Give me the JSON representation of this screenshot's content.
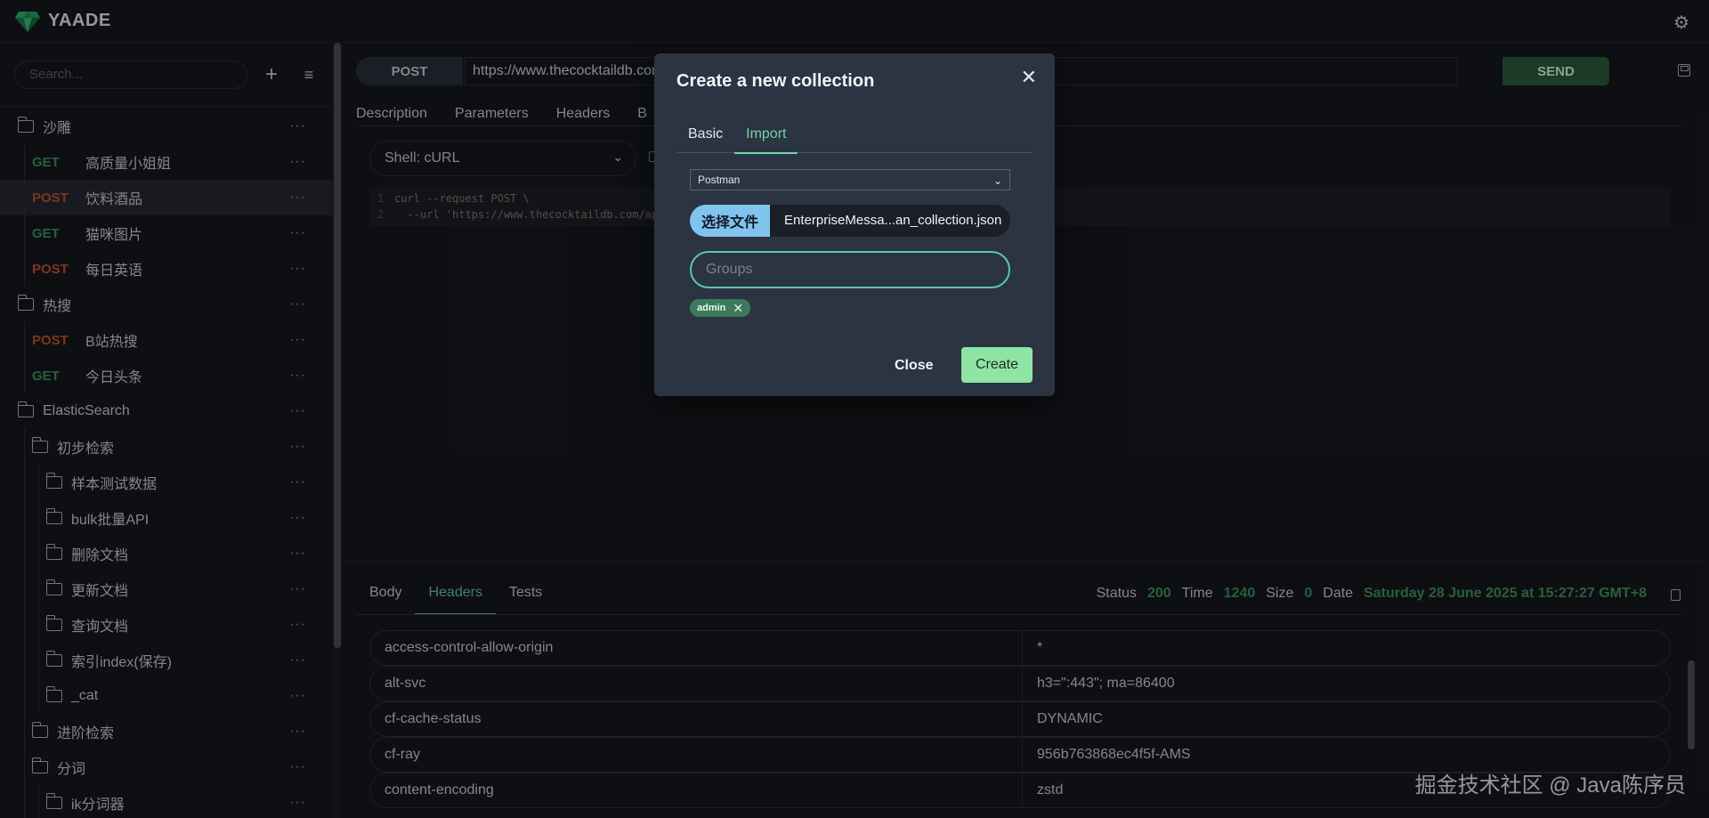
{
  "app": {
    "title": "YAADE"
  },
  "sidebar": {
    "search_placeholder": "Search...",
    "tree": [
      {
        "type": "folder",
        "label": "沙雕",
        "depth": 0
      },
      {
        "type": "request",
        "method": "GET",
        "label": "高质量小姐姐",
        "depth": 1
      },
      {
        "type": "request",
        "method": "POST",
        "label": "饮料酒品",
        "depth": 1,
        "selected": true
      },
      {
        "type": "request",
        "method": "GET",
        "label": "猫咪图片",
        "depth": 1
      },
      {
        "type": "request",
        "method": "POST",
        "label": "每日英语",
        "depth": 1
      },
      {
        "type": "folder",
        "label": "热搜",
        "depth": 0
      },
      {
        "type": "request",
        "method": "POST",
        "label": "B站热搜",
        "depth": 1
      },
      {
        "type": "request",
        "method": "GET",
        "label": "今日头条",
        "depth": 1
      },
      {
        "type": "folder",
        "label": "ElasticSearch",
        "depth": 0
      },
      {
        "type": "folder",
        "label": "初步检索",
        "depth": 1
      },
      {
        "type": "folder",
        "label": "样本测试数据",
        "depth": 2
      },
      {
        "type": "folder",
        "label": "bulk批量API",
        "depth": 2
      },
      {
        "type": "folder",
        "label": "删除文档",
        "depth": 2
      },
      {
        "type": "folder",
        "label": "更新文档",
        "depth": 2
      },
      {
        "type": "folder",
        "label": "查询文档",
        "depth": 2
      },
      {
        "type": "folder",
        "label": "索引index(保存)",
        "depth": 2
      },
      {
        "type": "folder",
        "label": "_cat",
        "depth": 2
      },
      {
        "type": "folder",
        "label": "进阶检索",
        "depth": 1
      },
      {
        "type": "folder",
        "label": "分词",
        "depth": 1
      },
      {
        "type": "folder",
        "label": "ik分词器",
        "depth": 2
      }
    ]
  },
  "request": {
    "method": "POST",
    "url": "https://www.thecocktaildb.com",
    "send_label": "SEND",
    "tabs": [
      "Description",
      "Parameters",
      "Headers",
      "B"
    ],
    "shell": "Shell: cURL",
    "code": [
      {
        "n": "1",
        "text": "curl --request POST \\"
      },
      {
        "n": "2",
        "text": "  --url 'https://www.thecocktaildb.com/ap"
      }
    ]
  },
  "response": {
    "tabs": [
      "Body",
      "Headers",
      "Tests"
    ],
    "active_tab": "Headers",
    "status_label": "Status",
    "status": "200",
    "time_label": "Time",
    "time": "1240",
    "size_label": "Size",
    "size": "0",
    "date_label": "Date",
    "date": "Saturday 28 June 2025 at 15:27:27 GMT+8",
    "headers": [
      {
        "key": "access-control-allow-origin",
        "value": "*"
      },
      {
        "key": "alt-svc",
        "value": "h3=\":443\"; ma=86400"
      },
      {
        "key": "cf-cache-status",
        "value": "DYNAMIC"
      },
      {
        "key": "cf-ray",
        "value": "956b763868ec4f5f-AMS"
      },
      {
        "key": "content-encoding",
        "value": "zstd"
      }
    ]
  },
  "modal": {
    "title": "Create a new collection",
    "tabs": [
      "Basic",
      "Import"
    ],
    "active_tab": "Import",
    "import_type": "Postman",
    "file_button": "选择文件",
    "file_name": "EnterpriseMessa...an_collection.json",
    "groups_placeholder": "Groups",
    "chips": [
      "admin"
    ],
    "close_label": "Close",
    "create_label": "Create"
  },
  "watermark": "掘金技术社区 @ Java陈序员",
  "colors": {
    "get": "#3f8f5f",
    "post": "#b9572e",
    "accent": "#6fd3a6",
    "send": "#2d5a3d"
  }
}
